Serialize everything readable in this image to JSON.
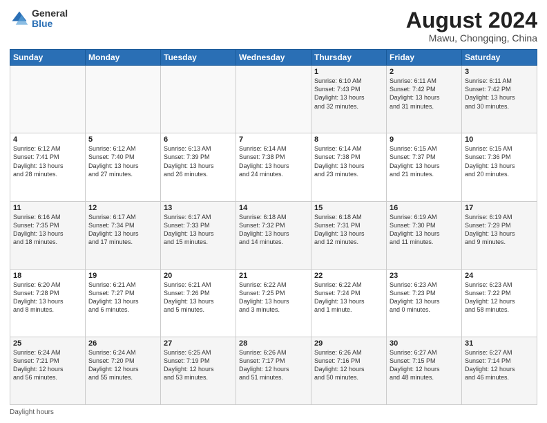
{
  "logo": {
    "general": "General",
    "blue": "Blue"
  },
  "title": "August 2024",
  "subtitle": "Mawu, Chongqing, China",
  "days_of_week": [
    "Sunday",
    "Monday",
    "Tuesday",
    "Wednesday",
    "Thursday",
    "Friday",
    "Saturday"
  ],
  "footer": "Daylight hours",
  "weeks": [
    [
      {
        "day": "",
        "info": ""
      },
      {
        "day": "",
        "info": ""
      },
      {
        "day": "",
        "info": ""
      },
      {
        "day": "",
        "info": ""
      },
      {
        "day": "1",
        "info": "Sunrise: 6:10 AM\nSunset: 7:43 PM\nDaylight: 13 hours\nand 32 minutes."
      },
      {
        "day": "2",
        "info": "Sunrise: 6:11 AM\nSunset: 7:42 PM\nDaylight: 13 hours\nand 31 minutes."
      },
      {
        "day": "3",
        "info": "Sunrise: 6:11 AM\nSunset: 7:42 PM\nDaylight: 13 hours\nand 30 minutes."
      }
    ],
    [
      {
        "day": "4",
        "info": "Sunrise: 6:12 AM\nSunset: 7:41 PM\nDaylight: 13 hours\nand 28 minutes."
      },
      {
        "day": "5",
        "info": "Sunrise: 6:12 AM\nSunset: 7:40 PM\nDaylight: 13 hours\nand 27 minutes."
      },
      {
        "day": "6",
        "info": "Sunrise: 6:13 AM\nSunset: 7:39 PM\nDaylight: 13 hours\nand 26 minutes."
      },
      {
        "day": "7",
        "info": "Sunrise: 6:14 AM\nSunset: 7:38 PM\nDaylight: 13 hours\nand 24 minutes."
      },
      {
        "day": "8",
        "info": "Sunrise: 6:14 AM\nSunset: 7:38 PM\nDaylight: 13 hours\nand 23 minutes."
      },
      {
        "day": "9",
        "info": "Sunrise: 6:15 AM\nSunset: 7:37 PM\nDaylight: 13 hours\nand 21 minutes."
      },
      {
        "day": "10",
        "info": "Sunrise: 6:15 AM\nSunset: 7:36 PM\nDaylight: 13 hours\nand 20 minutes."
      }
    ],
    [
      {
        "day": "11",
        "info": "Sunrise: 6:16 AM\nSunset: 7:35 PM\nDaylight: 13 hours\nand 18 minutes."
      },
      {
        "day": "12",
        "info": "Sunrise: 6:17 AM\nSunset: 7:34 PM\nDaylight: 13 hours\nand 17 minutes."
      },
      {
        "day": "13",
        "info": "Sunrise: 6:17 AM\nSunset: 7:33 PM\nDaylight: 13 hours\nand 15 minutes."
      },
      {
        "day": "14",
        "info": "Sunrise: 6:18 AM\nSunset: 7:32 PM\nDaylight: 13 hours\nand 14 minutes."
      },
      {
        "day": "15",
        "info": "Sunrise: 6:18 AM\nSunset: 7:31 PM\nDaylight: 13 hours\nand 12 minutes."
      },
      {
        "day": "16",
        "info": "Sunrise: 6:19 AM\nSunset: 7:30 PM\nDaylight: 13 hours\nand 11 minutes."
      },
      {
        "day": "17",
        "info": "Sunrise: 6:19 AM\nSunset: 7:29 PM\nDaylight: 13 hours\nand 9 minutes."
      }
    ],
    [
      {
        "day": "18",
        "info": "Sunrise: 6:20 AM\nSunset: 7:28 PM\nDaylight: 13 hours\nand 8 minutes."
      },
      {
        "day": "19",
        "info": "Sunrise: 6:21 AM\nSunset: 7:27 PM\nDaylight: 13 hours\nand 6 minutes."
      },
      {
        "day": "20",
        "info": "Sunrise: 6:21 AM\nSunset: 7:26 PM\nDaylight: 13 hours\nand 5 minutes."
      },
      {
        "day": "21",
        "info": "Sunrise: 6:22 AM\nSunset: 7:25 PM\nDaylight: 13 hours\nand 3 minutes."
      },
      {
        "day": "22",
        "info": "Sunrise: 6:22 AM\nSunset: 7:24 PM\nDaylight: 13 hours\nand 1 minute."
      },
      {
        "day": "23",
        "info": "Sunrise: 6:23 AM\nSunset: 7:23 PM\nDaylight: 13 hours\nand 0 minutes."
      },
      {
        "day": "24",
        "info": "Sunrise: 6:23 AM\nSunset: 7:22 PM\nDaylight: 12 hours\nand 58 minutes."
      }
    ],
    [
      {
        "day": "25",
        "info": "Sunrise: 6:24 AM\nSunset: 7:21 PM\nDaylight: 12 hours\nand 56 minutes."
      },
      {
        "day": "26",
        "info": "Sunrise: 6:24 AM\nSunset: 7:20 PM\nDaylight: 12 hours\nand 55 minutes."
      },
      {
        "day": "27",
        "info": "Sunrise: 6:25 AM\nSunset: 7:19 PM\nDaylight: 12 hours\nand 53 minutes."
      },
      {
        "day": "28",
        "info": "Sunrise: 6:26 AM\nSunset: 7:17 PM\nDaylight: 12 hours\nand 51 minutes."
      },
      {
        "day": "29",
        "info": "Sunrise: 6:26 AM\nSunset: 7:16 PM\nDaylight: 12 hours\nand 50 minutes."
      },
      {
        "day": "30",
        "info": "Sunrise: 6:27 AM\nSunset: 7:15 PM\nDaylight: 12 hours\nand 48 minutes."
      },
      {
        "day": "31",
        "info": "Sunrise: 6:27 AM\nSunset: 7:14 PM\nDaylight: 12 hours\nand 46 minutes."
      }
    ]
  ]
}
